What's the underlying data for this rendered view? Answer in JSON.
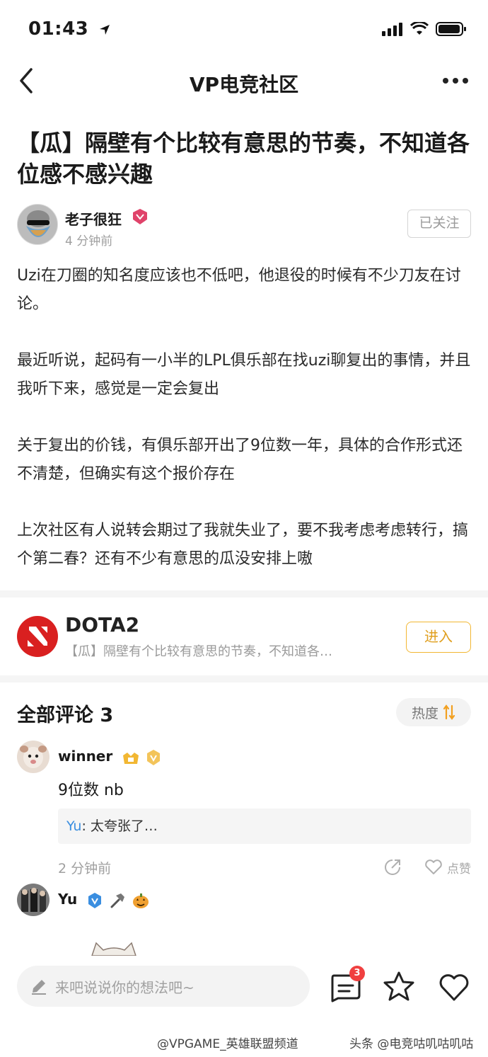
{
  "status_bar": {
    "time": "01:43"
  },
  "nav": {
    "title": "VP电竞社区"
  },
  "post": {
    "title": "【瓜】隔壁有个比较有意思的节奏，不知道各位感不感兴趣",
    "author": {
      "name": "老子很狂",
      "time": "4 分钟前",
      "follow_label": "已关注"
    },
    "paragraphs": [
      "Uzi在刀圈的知名度应该也不低吧，他退役的时候有不少刀友在讨论。",
      "最近听说，起码有一小半的LPL俱乐部在找uzi聊复出的事情，并且我听下来，感觉是一定会复出",
      "关于复出的价钱，有俱乐部开出了9位数一年，具体的合作形式还不清楚，但确实有这个报价存在",
      "上次社区有人说转会期过了我就失业了，要不我考虑考虑转行，搞个第二春？还有不少有意思的瓜没安排上嗷"
    ]
  },
  "community": {
    "name": "DOTA2",
    "subtitle": "【瓜】隔壁有个比较有意思的节奏，不知道各…",
    "enter_label": "进入"
  },
  "comments": {
    "title": "全部评论 3",
    "sort_label": "热度",
    "items": [
      {
        "user": "winner",
        "text": "9位数 nb",
        "reply_user": "Yu",
        "reply_text": ": 太夸张了…",
        "time": "2 分钟前",
        "like_label": "点赞"
      },
      {
        "user": "Yu"
      }
    ]
  },
  "bottom_bar": {
    "input_placeholder": "来吧说说你的想法吧~",
    "comment_count": "3"
  },
  "watermark": {
    "left": "@VPGAME_英雄联盟频道",
    "right": "头条 @电竞咕叽咕叽咕"
  },
  "colors": {
    "accent_gold": "#f2b733",
    "dota_red": "#d92020",
    "reply_blue": "#3a8ee0",
    "badge_red": "#f04040"
  }
}
